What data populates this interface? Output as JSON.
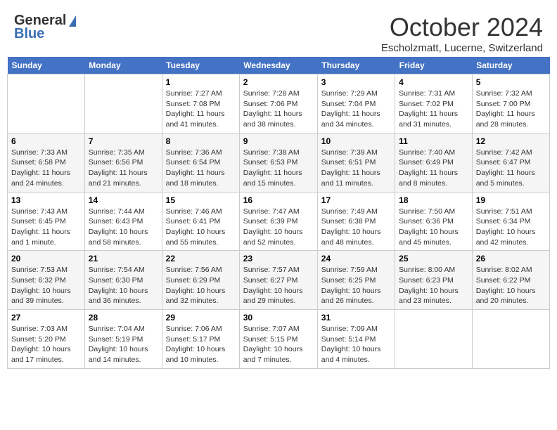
{
  "header": {
    "logo_general": "General",
    "logo_blue": "Blue",
    "month": "October 2024",
    "location": "Escholzmatt, Lucerne, Switzerland"
  },
  "days_of_week": [
    "Sunday",
    "Monday",
    "Tuesday",
    "Wednesday",
    "Thursday",
    "Friday",
    "Saturday"
  ],
  "weeks": [
    [
      {
        "day": "",
        "sunrise": "",
        "sunset": "",
        "daylight": ""
      },
      {
        "day": "",
        "sunrise": "",
        "sunset": "",
        "daylight": ""
      },
      {
        "day": "1",
        "sunrise": "Sunrise: 7:27 AM",
        "sunset": "Sunset: 7:08 PM",
        "daylight": "Daylight: 11 hours and 41 minutes."
      },
      {
        "day": "2",
        "sunrise": "Sunrise: 7:28 AM",
        "sunset": "Sunset: 7:06 PM",
        "daylight": "Daylight: 11 hours and 38 minutes."
      },
      {
        "day": "3",
        "sunrise": "Sunrise: 7:29 AM",
        "sunset": "Sunset: 7:04 PM",
        "daylight": "Daylight: 11 hours and 34 minutes."
      },
      {
        "day": "4",
        "sunrise": "Sunrise: 7:31 AM",
        "sunset": "Sunset: 7:02 PM",
        "daylight": "Daylight: 11 hours and 31 minutes."
      },
      {
        "day": "5",
        "sunrise": "Sunrise: 7:32 AM",
        "sunset": "Sunset: 7:00 PM",
        "daylight": "Daylight: 11 hours and 28 minutes."
      }
    ],
    [
      {
        "day": "6",
        "sunrise": "Sunrise: 7:33 AM",
        "sunset": "Sunset: 6:58 PM",
        "daylight": "Daylight: 11 hours and 24 minutes."
      },
      {
        "day": "7",
        "sunrise": "Sunrise: 7:35 AM",
        "sunset": "Sunset: 6:56 PM",
        "daylight": "Daylight: 11 hours and 21 minutes."
      },
      {
        "day": "8",
        "sunrise": "Sunrise: 7:36 AM",
        "sunset": "Sunset: 6:54 PM",
        "daylight": "Daylight: 11 hours and 18 minutes."
      },
      {
        "day": "9",
        "sunrise": "Sunrise: 7:38 AM",
        "sunset": "Sunset: 6:53 PM",
        "daylight": "Daylight: 11 hours and 15 minutes."
      },
      {
        "day": "10",
        "sunrise": "Sunrise: 7:39 AM",
        "sunset": "Sunset: 6:51 PM",
        "daylight": "Daylight: 11 hours and 11 minutes."
      },
      {
        "day": "11",
        "sunrise": "Sunrise: 7:40 AM",
        "sunset": "Sunset: 6:49 PM",
        "daylight": "Daylight: 11 hours and 8 minutes."
      },
      {
        "day": "12",
        "sunrise": "Sunrise: 7:42 AM",
        "sunset": "Sunset: 6:47 PM",
        "daylight": "Daylight: 11 hours and 5 minutes."
      }
    ],
    [
      {
        "day": "13",
        "sunrise": "Sunrise: 7:43 AM",
        "sunset": "Sunset: 6:45 PM",
        "daylight": "Daylight: 11 hours and 1 minute."
      },
      {
        "day": "14",
        "sunrise": "Sunrise: 7:44 AM",
        "sunset": "Sunset: 6:43 PM",
        "daylight": "Daylight: 10 hours and 58 minutes."
      },
      {
        "day": "15",
        "sunrise": "Sunrise: 7:46 AM",
        "sunset": "Sunset: 6:41 PM",
        "daylight": "Daylight: 10 hours and 55 minutes."
      },
      {
        "day": "16",
        "sunrise": "Sunrise: 7:47 AM",
        "sunset": "Sunset: 6:39 PM",
        "daylight": "Daylight: 10 hours and 52 minutes."
      },
      {
        "day": "17",
        "sunrise": "Sunrise: 7:49 AM",
        "sunset": "Sunset: 6:38 PM",
        "daylight": "Daylight: 10 hours and 48 minutes."
      },
      {
        "day": "18",
        "sunrise": "Sunrise: 7:50 AM",
        "sunset": "Sunset: 6:36 PM",
        "daylight": "Daylight: 10 hours and 45 minutes."
      },
      {
        "day": "19",
        "sunrise": "Sunrise: 7:51 AM",
        "sunset": "Sunset: 6:34 PM",
        "daylight": "Daylight: 10 hours and 42 minutes."
      }
    ],
    [
      {
        "day": "20",
        "sunrise": "Sunrise: 7:53 AM",
        "sunset": "Sunset: 6:32 PM",
        "daylight": "Daylight: 10 hours and 39 minutes."
      },
      {
        "day": "21",
        "sunrise": "Sunrise: 7:54 AM",
        "sunset": "Sunset: 6:30 PM",
        "daylight": "Daylight: 10 hours and 36 minutes."
      },
      {
        "day": "22",
        "sunrise": "Sunrise: 7:56 AM",
        "sunset": "Sunset: 6:29 PM",
        "daylight": "Daylight: 10 hours and 32 minutes."
      },
      {
        "day": "23",
        "sunrise": "Sunrise: 7:57 AM",
        "sunset": "Sunset: 6:27 PM",
        "daylight": "Daylight: 10 hours and 29 minutes."
      },
      {
        "day": "24",
        "sunrise": "Sunrise: 7:59 AM",
        "sunset": "Sunset: 6:25 PM",
        "daylight": "Daylight: 10 hours and 26 minutes."
      },
      {
        "day": "25",
        "sunrise": "Sunrise: 8:00 AM",
        "sunset": "Sunset: 6:23 PM",
        "daylight": "Daylight: 10 hours and 23 minutes."
      },
      {
        "day": "26",
        "sunrise": "Sunrise: 8:02 AM",
        "sunset": "Sunset: 6:22 PM",
        "daylight": "Daylight: 10 hours and 20 minutes."
      }
    ],
    [
      {
        "day": "27",
        "sunrise": "Sunrise: 7:03 AM",
        "sunset": "Sunset: 5:20 PM",
        "daylight": "Daylight: 10 hours and 17 minutes."
      },
      {
        "day": "28",
        "sunrise": "Sunrise: 7:04 AM",
        "sunset": "Sunset: 5:19 PM",
        "daylight": "Daylight: 10 hours and 14 minutes."
      },
      {
        "day": "29",
        "sunrise": "Sunrise: 7:06 AM",
        "sunset": "Sunset: 5:17 PM",
        "daylight": "Daylight: 10 hours and 10 minutes."
      },
      {
        "day": "30",
        "sunrise": "Sunrise: 7:07 AM",
        "sunset": "Sunset: 5:15 PM",
        "daylight": "Daylight: 10 hours and 7 minutes."
      },
      {
        "day": "31",
        "sunrise": "Sunrise: 7:09 AM",
        "sunset": "Sunset: 5:14 PM",
        "daylight": "Daylight: 10 hours and 4 minutes."
      },
      {
        "day": "",
        "sunrise": "",
        "sunset": "",
        "daylight": ""
      },
      {
        "day": "",
        "sunrise": "",
        "sunset": "",
        "daylight": ""
      }
    ]
  ]
}
